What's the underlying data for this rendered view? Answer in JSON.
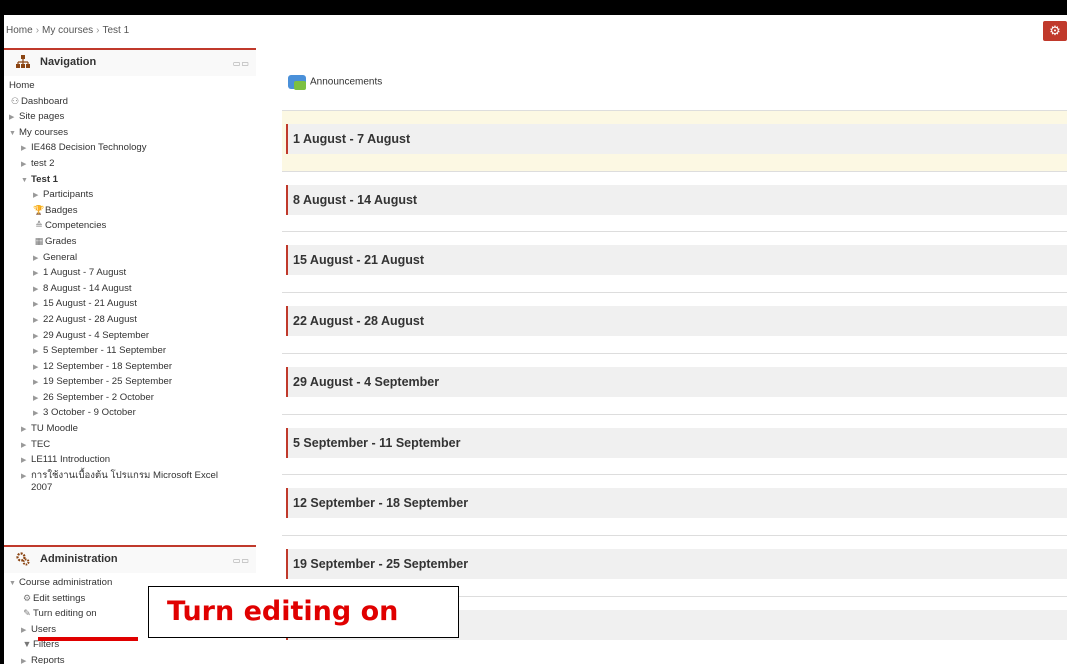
{
  "breadcrumb": [
    "Home",
    "My courses",
    "Test 1"
  ],
  "breadcrumb_sep": "›",
  "navigation": {
    "title": "Navigation",
    "items": [
      {
        "label": "Home",
        "indent": 0,
        "arrow": "",
        "icon": ""
      },
      {
        "label": "Dashboard",
        "indent": 0,
        "arrow": "",
        "icon": "dashboard-icon"
      },
      {
        "label": "Site pages",
        "indent": 0,
        "arrow": "▶",
        "icon": ""
      },
      {
        "label": "My courses",
        "indent": 0,
        "arrow": "▼",
        "icon": ""
      },
      {
        "label": "IE468 Decision Technology",
        "indent": 1,
        "arrow": "▶",
        "icon": ""
      },
      {
        "label": "test 2",
        "indent": 1,
        "arrow": "▶",
        "icon": ""
      },
      {
        "label": "Test 1",
        "indent": 1,
        "arrow": "▼",
        "icon": "",
        "bold": true
      },
      {
        "label": "Participants",
        "indent": 2,
        "arrow": "▶",
        "icon": ""
      },
      {
        "label": "Badges",
        "indent": 2,
        "arrow": "",
        "icon": "badge-icon"
      },
      {
        "label": "Competencies",
        "indent": 2,
        "arrow": "",
        "icon": "competencies-icon"
      },
      {
        "label": "Grades",
        "indent": 2,
        "arrow": "",
        "icon": "grades-icon"
      },
      {
        "label": "General",
        "indent": 2,
        "arrow": "▶",
        "icon": ""
      },
      {
        "label": "1 August - 7 August",
        "indent": 2,
        "arrow": "▶",
        "icon": ""
      },
      {
        "label": "8 August - 14 August",
        "indent": 2,
        "arrow": "▶",
        "icon": ""
      },
      {
        "label": "15 August - 21 August",
        "indent": 2,
        "arrow": "▶",
        "icon": ""
      },
      {
        "label": "22 August - 28 August",
        "indent": 2,
        "arrow": "▶",
        "icon": ""
      },
      {
        "label": "29 August - 4 September",
        "indent": 2,
        "arrow": "▶",
        "icon": ""
      },
      {
        "label": "5 September - 11 September",
        "indent": 2,
        "arrow": "▶",
        "icon": ""
      },
      {
        "label": "12 September - 18 September",
        "indent": 2,
        "arrow": "▶",
        "icon": ""
      },
      {
        "label": "19 September - 25 September",
        "indent": 2,
        "arrow": "▶",
        "icon": ""
      },
      {
        "label": "26 September - 2 October",
        "indent": 2,
        "arrow": "▶",
        "icon": ""
      },
      {
        "label": "3 October - 9 October",
        "indent": 2,
        "arrow": "▶",
        "icon": ""
      },
      {
        "label": "TU Moodle",
        "indent": 1,
        "arrow": "▶",
        "icon": ""
      },
      {
        "label": "TEC",
        "indent": 1,
        "arrow": "▶",
        "icon": ""
      },
      {
        "label": "LE111 Introduction",
        "indent": 1,
        "arrow": "▶",
        "icon": ""
      },
      {
        "label": "การใช้งานเบื้องต้น โปรแกรม Microsoft Excel 2007",
        "indent": 1,
        "arrow": "▶",
        "icon": "",
        "wrap": true
      }
    ]
  },
  "administration": {
    "title": "Administration",
    "items": [
      {
        "label": "Course administration",
        "indent": 0,
        "arrow": "▼",
        "icon": ""
      },
      {
        "label": "Edit settings",
        "indent": 1,
        "arrow": "",
        "icon": "gear-icon"
      },
      {
        "label": "Turn editing on",
        "indent": 1,
        "arrow": "",
        "icon": "pencil-icon"
      },
      {
        "label": "Users",
        "indent": 1,
        "arrow": "▶",
        "icon": ""
      },
      {
        "label": "Filters",
        "indent": 1,
        "arrow": "",
        "icon": "filter-icon"
      },
      {
        "label": "Reports",
        "indent": 1,
        "arrow": "▶",
        "icon": ""
      }
    ]
  },
  "main": {
    "announcements": "Announcements",
    "sections": [
      "1 August - 7 August",
      "8 August - 14 August",
      "15 August - 21 August",
      "22 August - 28 August",
      "29 August - 4 September",
      "5 September - 11 September",
      "12 September - 18 September",
      "19 September - 25 September",
      ""
    ]
  },
  "annotation": {
    "callout_text": "Turn editing on"
  },
  "colors": {
    "accent": "#c0392b",
    "annotation_red": "#e00000",
    "highlight": "#fcf8e3"
  }
}
